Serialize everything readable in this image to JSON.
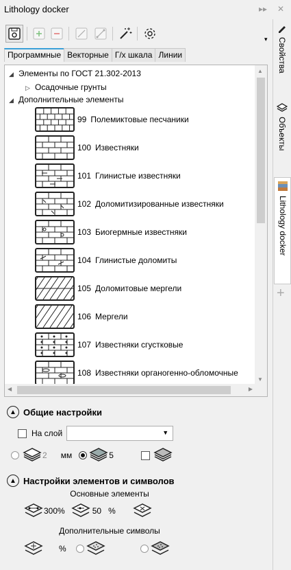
{
  "window": {
    "title": "Lithology docker",
    "expand_glyph": "▸▸",
    "close_glyph": "✕"
  },
  "toolbar": {
    "items": [
      {
        "name": "save-icon"
      },
      {
        "name": "add-icon"
      },
      {
        "name": "remove-icon"
      },
      {
        "name": "line-icon"
      },
      {
        "name": "connector-icon"
      },
      {
        "name": "magic-wand-icon"
      },
      {
        "name": "gear-icon"
      }
    ],
    "overflow_glyph": "▾"
  },
  "tabs": [
    "Программные",
    "Векторные",
    "Г/х шкала",
    "Линии"
  ],
  "tree": {
    "root1": "Элементы по ГОСТ 21.302-2013",
    "child1": "Осадочные грунты",
    "root2": "Дополнительные элементы",
    "items": [
      {
        "num": "99",
        "label": "Полемиктовые песчаники",
        "pattern": "brick-small"
      },
      {
        "num": "100",
        "label": "Известняки",
        "pattern": "brick"
      },
      {
        "num": "101",
        "label": "Глинистые известняки",
        "pattern": "brick-dash"
      },
      {
        "num": "102",
        "label": "Доломитизированные известняки",
        "pattern": "brick-tick"
      },
      {
        "num": "103",
        "label": "Биогермные известняки",
        "pattern": "brick-bio"
      },
      {
        "num": "104",
        "label": "Глинистые доломиты",
        "pattern": "brick-slant"
      },
      {
        "num": "105",
        "label": "Доломитовые мергели",
        "pattern": "slant-brick"
      },
      {
        "num": "106",
        "label": "Мергели",
        "pattern": "slant"
      },
      {
        "num": "107",
        "label": "Известняки сгустковые",
        "pattern": "brick-dots"
      },
      {
        "num": "108",
        "label": "Известняки органогенно-обломочные",
        "pattern": "brick-oval"
      }
    ]
  },
  "general": {
    "title": "Общие настройки",
    "on_layer_label": "На слой",
    "layer_value": "",
    "val1": "2",
    "unit": "мм",
    "val2": "5"
  },
  "elements": {
    "title": "Настройки элементов и символов",
    "main_label": "Основные элементы",
    "scale1": "300",
    "pct1": "%",
    "scale2": "50",
    "pct2": "%",
    "extra_label": "Дополнительные символы",
    "pct3": "%"
  },
  "sidebar": {
    "tabs": [
      "Свойства",
      "Объекты",
      "Lithology docker"
    ],
    "add_glyph": "+"
  },
  "colors": {
    "accent": "#3aa0d8",
    "border": "#b4b4b4"
  }
}
